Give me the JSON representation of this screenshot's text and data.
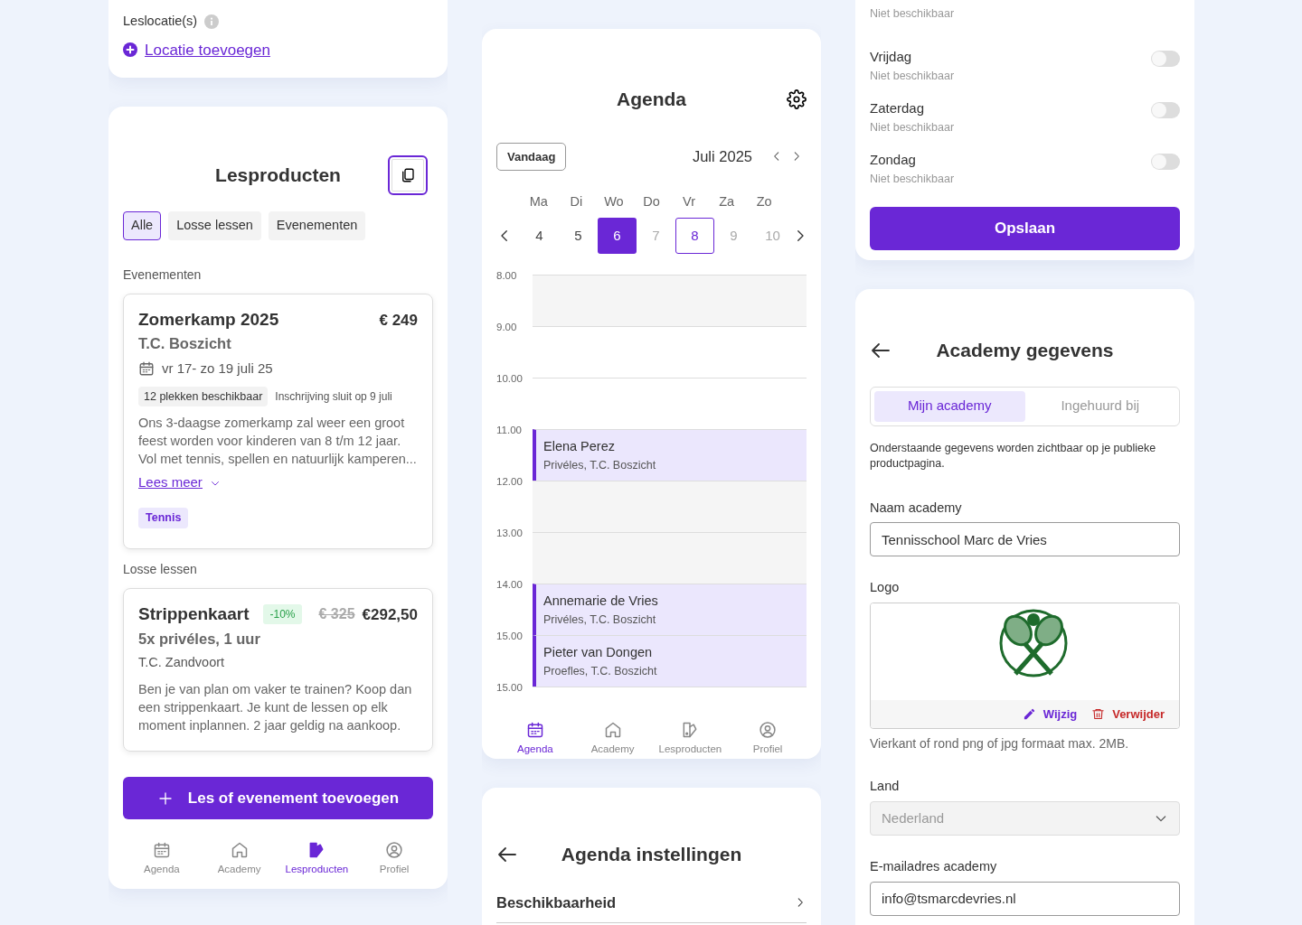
{
  "location_card": {
    "label": "Leslocatie(s)",
    "add_link": "Locatie toevoegen"
  },
  "products": {
    "title": "Lesproducten",
    "filters": [
      {
        "label": "Alle",
        "selected": true
      },
      {
        "label": "Losse lessen",
        "selected": false
      },
      {
        "label": "Evenementen",
        "selected": false
      }
    ],
    "sections": [
      {
        "heading": "Evenementen",
        "items": [
          {
            "kind": "event",
            "title": "Zomerkamp 2025",
            "price": "€ 249",
            "venue": "T.C. Boszicht",
            "date": "vr 17- zo 19 juli 25",
            "spots": "12 plekken beschikbaar",
            "deadline": "Inschrijving sluit op 9 juli",
            "description": "Ons 3-daagse zomerkamp zal weer een groot feest worden voor kinderen van 8 t/m 12 jaar. Vol met tennis, spellen en natuurlijk kamperen...",
            "read_more": "Lees meer",
            "tags": [
              "Tennis"
            ]
          }
        ]
      },
      {
        "heading": "Losse lessen",
        "items": [
          {
            "kind": "lesson",
            "title": "Strippenkaart",
            "discount": "-10%",
            "old_price": "€ 325",
            "price": "€292,50",
            "subtitle": "5x privéles, 1 uur",
            "venue": "T.C. Zandvoort",
            "description": "Ben je van plan om vaker te trainen? Koop dan een strippenkaart. Je kunt de lessen op elk moment inplannen. 2 jaar geldig na aankoop."
          }
        ]
      }
    ],
    "add_button": "Les of evenement toevoegen",
    "nav": [
      {
        "kind": "calendar",
        "label": "Agenda",
        "selected": false
      },
      {
        "kind": "home",
        "label": "Academy",
        "selected": false
      },
      {
        "kind": "products",
        "label": "Lesproducten",
        "selected": true
      },
      {
        "kind": "profile",
        "label": "Profiel",
        "selected": false
      }
    ]
  },
  "agenda": {
    "title": "Agenda",
    "today_button": "Vandaag",
    "month": "Juli 2025",
    "weekdays": [
      "Ma",
      "Di",
      "Wo",
      "Do",
      "Vr",
      "Za",
      "Zo"
    ],
    "days": [
      {
        "label": "4",
        "selected": false,
        "today": false,
        "disabled": false
      },
      {
        "label": "5",
        "selected": false,
        "today": false,
        "disabled": false
      },
      {
        "label": "6",
        "selected": true,
        "today": false,
        "disabled": false
      },
      {
        "label": "7",
        "selected": false,
        "today": false,
        "disabled": true
      },
      {
        "label": "8",
        "selected": false,
        "today": true,
        "disabled": false
      },
      {
        "label": "9",
        "selected": false,
        "today": false,
        "disabled": true
      },
      {
        "label": "10",
        "selected": false,
        "today": false,
        "disabled": true
      }
    ],
    "hours": [
      "8.00",
      "9.00",
      "10.00",
      "11.00",
      "12.00",
      "13.00",
      "14.00",
      "15.00",
      "15.00"
    ],
    "slots": [
      {
        "kind": "unavailable"
      },
      {
        "kind": "free"
      },
      {
        "kind": "free"
      },
      {
        "kind": "event",
        "name": "Elena Perez",
        "detail": "Privéles, T.C. Boszicht"
      },
      {
        "kind": "unavailable"
      },
      {
        "kind": "unavailable"
      },
      {
        "kind": "event",
        "name": "Annemarie de Vries",
        "detail": "Privéles, T.C. Boszicht"
      },
      {
        "kind": "event",
        "name": "Pieter van Dongen",
        "detail": "Proefles, T.C. Boszicht"
      }
    ],
    "nav": [
      {
        "kind": "calendar",
        "label": "Agenda",
        "selected": true
      },
      {
        "kind": "home",
        "label": "Academy",
        "selected": false
      },
      {
        "kind": "products",
        "label": "Lesproducten",
        "selected": false
      },
      {
        "kind": "profile",
        "label": "Profiel",
        "selected": false
      }
    ]
  },
  "agenda_settings": {
    "title": "Agenda instellingen",
    "items": [
      "Beschikbaarheid"
    ]
  },
  "availability": {
    "days": [
      {
        "note": "Niet beschikbaar"
      },
      {
        "day": "Vrijdag",
        "note": "Niet beschikbaar",
        "on": false
      },
      {
        "day": "Zaterdag",
        "note": "Niet beschikbaar",
        "on": false
      },
      {
        "day": "Zondag",
        "note": "Niet beschikbaar",
        "on": false
      }
    ],
    "save_button": "Opslaan"
  },
  "academy": {
    "title": "Academy gegevens",
    "tabs": [
      {
        "label": "Mijn academy",
        "selected": true
      },
      {
        "label": "Ingehuurd bij",
        "selected": false
      }
    ],
    "intro": "Onderstaande gegevens worden zichtbaar op je publieke productpagina.",
    "name_label": "Naam academy",
    "name_value": "Tennisschool Marc de Vries",
    "logo_label": "Logo",
    "logo_edit": "Wijzig",
    "logo_delete": "Verwijder",
    "logo_hint": "Vierkant of rond png of jpg formaat max. 2MB.",
    "country_label": "Land",
    "country_value": "Nederland",
    "country_disabled": true,
    "email_label": "E-mailadres academy",
    "email_value": "info@tsmarcdevries.nl"
  }
}
